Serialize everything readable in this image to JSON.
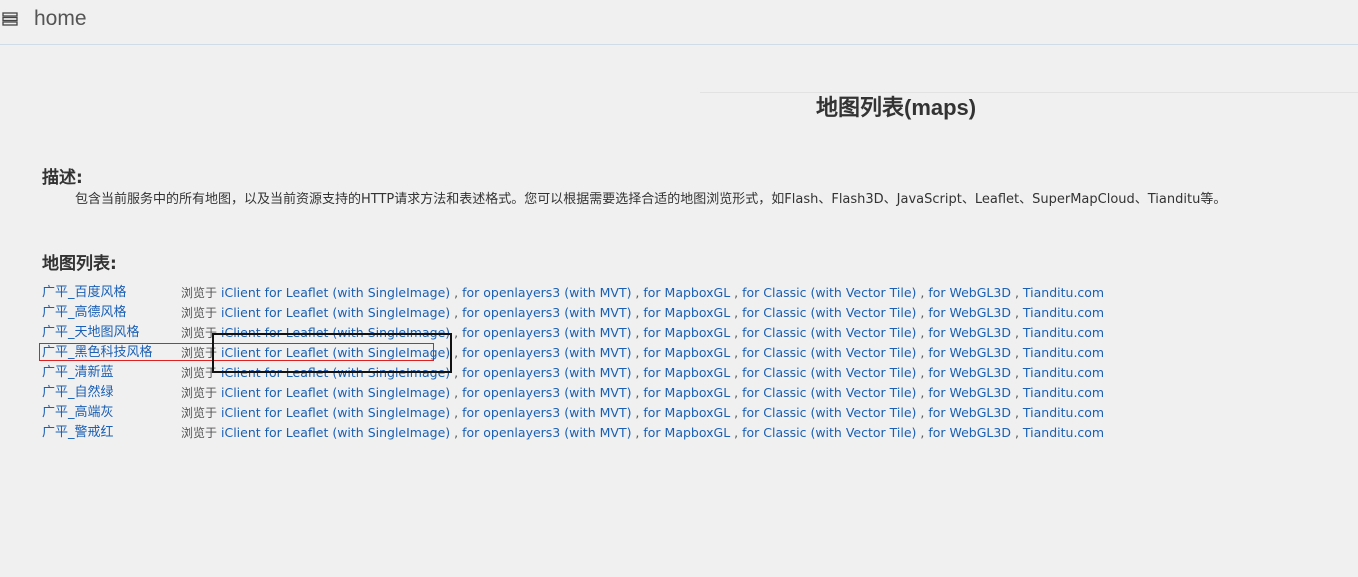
{
  "header": {
    "title": "home",
    "menu_icon": "menu-icon"
  },
  "page_title": "地图列表(maps)",
  "description": {
    "heading": "描述:",
    "text": "包含当前服务中的所有地图，以及当前资源支持的HTTP请求方法和表述格式。您可以根据需要选择合适的地图浏览形式，如Flash、Flash3D、JavaScript、Leaflet、SuperMapCloud、Tianditu等。"
  },
  "map_list": {
    "heading": "地图列表:",
    "browse_label": "浏览于",
    "separator": " , ",
    "link_labels": [
      "iClient for Leaflet (with SingleImage)",
      "for openlayers3 (with MVT)",
      "for MapboxGL",
      "for Classic (with Vector Tile)",
      "for WebGL3D",
      "Tianditu.com"
    ],
    "maps": [
      {
        "name": "广平_百度风格"
      },
      {
        "name": "广平_高德风格"
      },
      {
        "name": "广平_天地图风格"
      },
      {
        "name": "广平_黑色科技风格"
      },
      {
        "name": "广平_清新蓝"
      },
      {
        "name": "广平_自然绿"
      },
      {
        "name": "广平_高端灰"
      },
      {
        "name": "广平_警戒红"
      }
    ]
  },
  "annotations": {
    "highlight_color": "#e02020",
    "box_color": "#111111"
  }
}
